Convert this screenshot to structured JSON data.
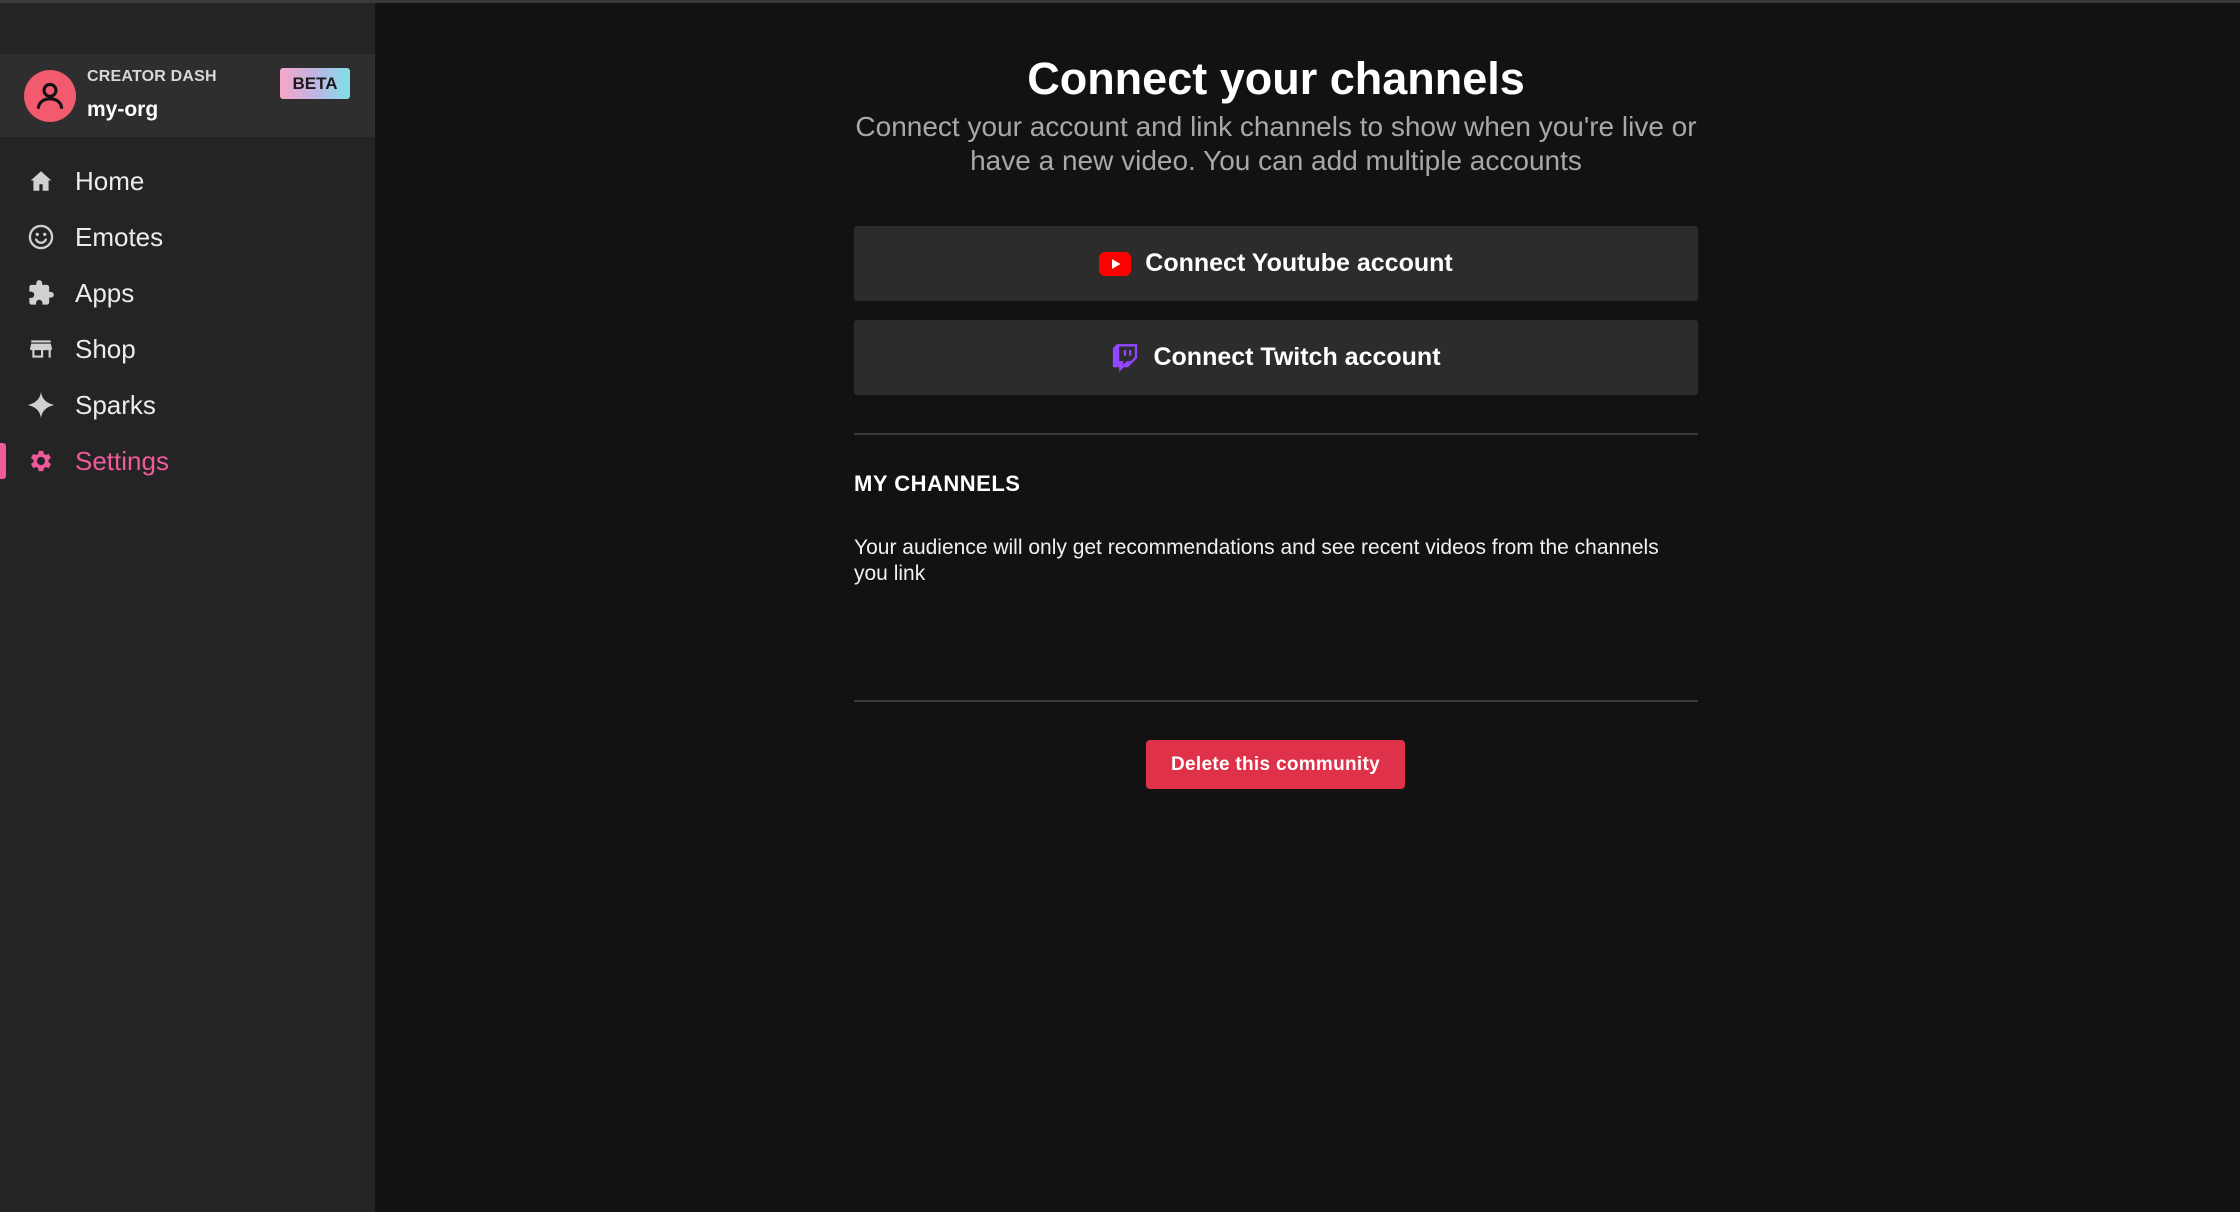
{
  "sidebar": {
    "org": {
      "label": "CREATOR DASH",
      "name": "my-org",
      "badge": "BETA",
      "avatar_icon": "user-icon",
      "avatar_color": "#f25a6e"
    },
    "items": [
      {
        "label": "Home",
        "icon": "home-icon"
      },
      {
        "label": "Emotes",
        "icon": "smiley-icon"
      },
      {
        "label": "Apps",
        "icon": "puzzle-icon"
      },
      {
        "label": "Shop",
        "icon": "store-icon"
      },
      {
        "label": "Sparks",
        "icon": "sparkle-icon"
      },
      {
        "label": "Settings",
        "icon": "gear-icon",
        "active": true
      }
    ],
    "active_color": "#ef5a9a"
  },
  "main": {
    "title": "Connect your channels",
    "subtitle": "Connect your account and link channels to show when you're live or have a new video. You can add multiple accounts",
    "youtube_button": {
      "label": "Connect Youtube account",
      "icon": "youtube-icon",
      "icon_color": "#ff0000"
    },
    "twitch_button": {
      "label": "Connect Twitch account",
      "icon": "twitch-icon",
      "icon_color": "#9146ff"
    },
    "my_channels": {
      "heading": "MY CHANNELS",
      "description": "Your audience will only get recommendations and see recent videos from the channels you link"
    },
    "delete_button": {
      "label": "Delete this community",
      "color": "#e0314b"
    }
  }
}
